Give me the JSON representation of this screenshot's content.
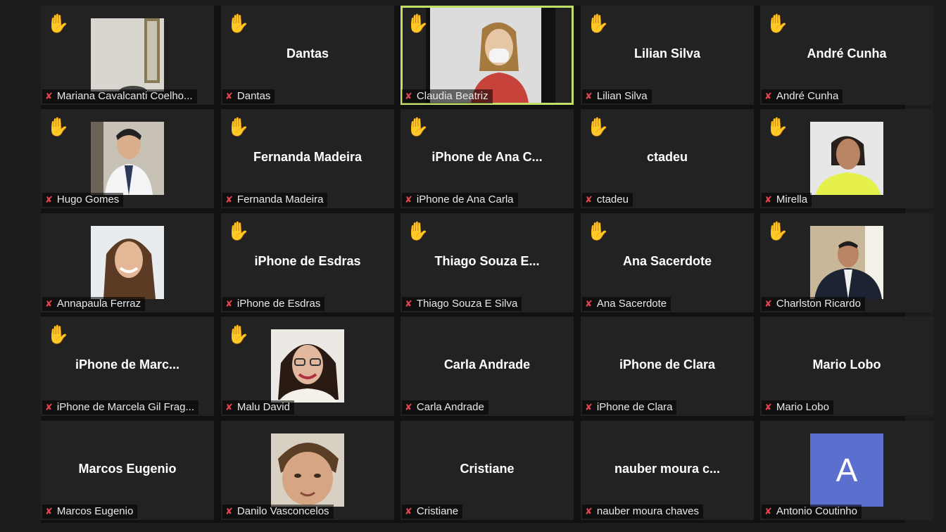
{
  "participants": [
    {
      "label": "Mariana Cavalcanti Coelho...",
      "hand": true,
      "video": "room"
    },
    {
      "label": "Dantas",
      "display": "Dantas",
      "hand": true
    },
    {
      "label": "Claudia Beatriz",
      "hand": true,
      "video": "woman-mask",
      "active": true
    },
    {
      "label": "Lilian Silva",
      "display": "Lilian Silva",
      "hand": true
    },
    {
      "label": "André Cunha",
      "display": "André Cunha",
      "hand": true
    },
    {
      "label": "Hugo Gomes",
      "hand": true,
      "video": "man-doctor"
    },
    {
      "label": "Fernanda Madeira",
      "display": "Fernanda Madeira",
      "hand": true
    },
    {
      "label": "iPhone de Ana Carla",
      "display": "iPhone de Ana C...",
      "hand": true
    },
    {
      "label": "ctadeu",
      "display": "ctadeu",
      "hand": true
    },
    {
      "label": "Mirella",
      "hand": true,
      "video": "woman-yellow"
    },
    {
      "label": "Annapaula Ferraz",
      "hand": false,
      "video": "woman-smile"
    },
    {
      "label": "iPhone de Esdras",
      "display": "iPhone de Esdras",
      "hand": true
    },
    {
      "label": "Thiago Souza E Silva",
      "display": "Thiago Souza E...",
      "hand": true
    },
    {
      "label": "Ana Sacerdote",
      "display": "Ana Sacerdote",
      "hand": true
    },
    {
      "label": "Charlston Ricardo",
      "hand": true,
      "video": "man-suit"
    },
    {
      "label": "iPhone de Marcela Gil Frag...",
      "display": "iPhone de Marc...",
      "hand": true
    },
    {
      "label": "Malu David",
      "hand": true,
      "video": "woman-glasses"
    },
    {
      "label": "Carla Andrade",
      "display": "Carla Andrade",
      "hand": false
    },
    {
      "label": "iPhone de Clara",
      "display": "iPhone de Clara",
      "hand": false
    },
    {
      "label": "Mario Lobo",
      "display": "Mario Lobo",
      "hand": false
    },
    {
      "label": "Marcos Eugenio",
      "display": "Marcos Eugenio",
      "hand": false
    },
    {
      "label": "Danilo Vasconcelos",
      "hand": false,
      "video": "boy"
    },
    {
      "label": "Cristiane",
      "display": "Cristiane",
      "hand": false
    },
    {
      "label": "nauber moura chaves",
      "display": "nauber moura c...",
      "hand": false
    },
    {
      "label": "Antonio Coutinho",
      "hand": false,
      "avatar": "A"
    }
  ],
  "icons": {
    "hand": "raised-hand-icon",
    "mic": "mic-muted-icon"
  },
  "colors": {
    "active_border": "#c4e06a",
    "hand": "#f2c94c",
    "mic": "#e0454d",
    "avatar_bg": "#5b6fcf"
  }
}
